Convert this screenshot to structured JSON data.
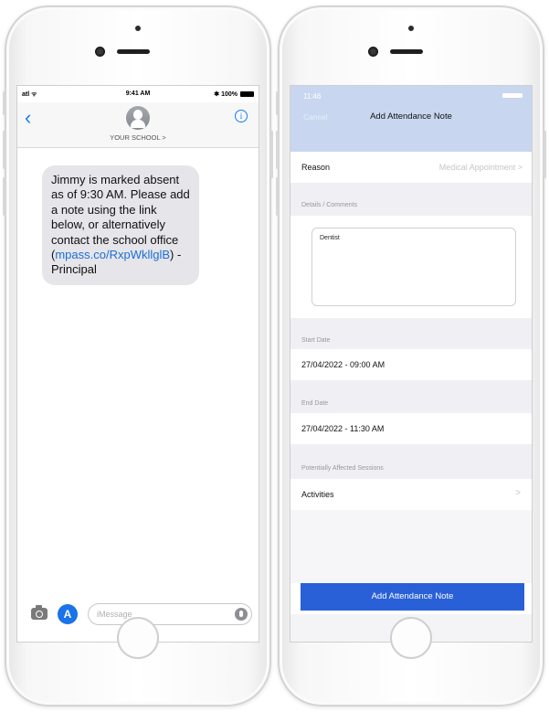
{
  "left_phone": {
    "status": {
      "signal": "atl ᯤ",
      "time": "9:41 AM",
      "battery": "✱ 100%"
    },
    "header": {
      "contact_name": "YOUR SCHOOL >",
      "back_glyph": "‹",
      "info_glyph": "i"
    },
    "message": {
      "text": "Jimmy is marked absent as of 9:30 AM. Please add a note using the link below, or alternatively contact the school office (",
      "link": "mpass.co/RxpWkllglB",
      "suffix": ") - Principal"
    },
    "input": {
      "placeholder": "iMessage",
      "appstore_glyph": "A"
    }
  },
  "right_phone": {
    "status": {
      "time": "11:46"
    },
    "nav": {
      "cancel": "Cancel",
      "title": "Add Attendance Note"
    },
    "reason": {
      "label": "Reason",
      "value": "Medical Appointment >"
    },
    "details": {
      "section": "Details / Comments",
      "text": "Dentist"
    },
    "start_date": {
      "section": "Start Date",
      "value": "27/04/2022 - 09:00 AM"
    },
    "end_date": {
      "section": "End Date",
      "value": "27/04/2022 - 11:30 AM"
    },
    "sessions": {
      "section": "Potentially Affected Sessions",
      "label": "Activities",
      "chevron": ">"
    },
    "submit_label": "Add Attendance Note"
  }
}
